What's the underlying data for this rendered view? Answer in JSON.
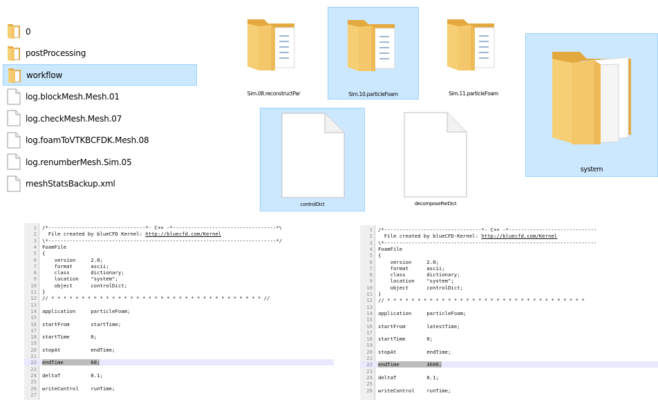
{
  "file_list": [
    {
      "name": "0",
      "icon": "folder-icon",
      "selected": false
    },
    {
      "name": "postProcessing",
      "icon": "folder-icon",
      "selected": false
    },
    {
      "name": "workflow",
      "icon": "folder-icon",
      "selected": true
    },
    {
      "name": "log.blockMesh.Mesh.01",
      "icon": "file-icon",
      "selected": false
    },
    {
      "name": "log.checkMesh.Mesh.07",
      "icon": "file-icon",
      "selected": false
    },
    {
      "name": "log.foamToVTKBCFDK.Mesh.08",
      "icon": "file-icon",
      "selected": false
    },
    {
      "name": "log.renumberMesh.Sim.05",
      "icon": "file-icon",
      "selected": false
    },
    {
      "name": "meshStatsBackup.xml",
      "icon": "file-icon",
      "selected": false
    }
  ],
  "icons": {
    "sim08": "Sim.08.reconstructPar",
    "sim10": "Sim.10.particleFoam",
    "sim11": "Sim.11.particleFoam",
    "system": "system",
    "controlDict": "controlDict",
    "decomposeParDict": "decomposeParDict"
  },
  "colors": {
    "selection_bg": "#cce8ff",
    "selection_border": "#99d1ff",
    "folder": "#f4c86a",
    "highlight_line": "#e8e8ff"
  },
  "editor_left": {
    "lines": [
      {
        "n": "1",
        "text": "/*--------------------------------*- C++ -*----------------------------------*\\"
      },
      {
        "n": "2",
        "text": "  File created by blueCFD Kernel: ",
        "url": "http://bluecfd.com/Kernel"
      },
      {
        "n": "3",
        "text": "\\*---------------------------------------------------------------------------*/"
      },
      {
        "n": "4",
        "text": "FoamFile"
      },
      {
        "n": "5",
        "text": "{"
      },
      {
        "n": "6",
        "text": "    version     2.0;"
      },
      {
        "n": "7",
        "text": "    format      ascii;"
      },
      {
        "n": "8",
        "text": "    class       dictionary;"
      },
      {
        "n": "9",
        "text": "    location    \"system\";"
      },
      {
        "n": "10",
        "text": "    object      controlDict;"
      },
      {
        "n": "11",
        "text": "}"
      },
      {
        "n": "12",
        "text": "// * * * * * * * * * * * * * * * * * * * * * * * * * * * * * * * * * * * //"
      },
      {
        "n": "13",
        "text": ""
      },
      {
        "n": "14",
        "text": "application     particleFoam;"
      },
      {
        "n": "15",
        "text": ""
      },
      {
        "n": "16",
        "text": "startFrom       startTime;"
      },
      {
        "n": "17",
        "text": ""
      },
      {
        "n": "18",
        "text": "startTime       0;"
      },
      {
        "n": "19",
        "text": ""
      },
      {
        "n": "20",
        "text": "stopAt          endTime;"
      },
      {
        "n": "21",
        "text": ""
      },
      {
        "n": "22",
        "text": "endTime         60;",
        "highlight": true
      },
      {
        "n": "23",
        "text": ""
      },
      {
        "n": "24",
        "text": "deltaT          0.1;"
      },
      {
        "n": "25",
        "text": ""
      },
      {
        "n": "26",
        "text": "writeControl    runTime;"
      },
      {
        "n": "27",
        "text": ""
      }
    ]
  },
  "editor_right": {
    "lines": [
      {
        "n": "1",
        "text": "/*--------------------------------*- C++ -*-----------------------------"
      },
      {
        "n": "2",
        "text": "  File created by blueCFD-Kernel: ",
        "url": "http://bluecfd.com/Kernel"
      },
      {
        "n": "3",
        "text": "\\*----------------------------------------------------------------------"
      },
      {
        "n": "4",
        "text": "FoamFile"
      },
      {
        "n": "5",
        "text": "{"
      },
      {
        "n": "6",
        "text": "    version     2.0;"
      },
      {
        "n": "7",
        "text": "    format      ascii;"
      },
      {
        "n": "8",
        "text": "    class       dictionary;"
      },
      {
        "n": "9",
        "text": "    location    \"system\";"
      },
      {
        "n": "10",
        "text": "    object      controlDict;"
      },
      {
        "n": "11",
        "text": "}"
      },
      {
        "n": "12",
        "text": "// * * * * * * * * * * * * * * * * * * * * * * * * * * * * * * * * *"
      },
      {
        "n": "13",
        "text": ""
      },
      {
        "n": "14",
        "text": "application     particleFoam;"
      },
      {
        "n": "15",
        "text": ""
      },
      {
        "n": "16",
        "text": "startFrom       latestTime;"
      },
      {
        "n": "17",
        "text": ""
      },
      {
        "n": "18",
        "text": "startTime       0;"
      },
      {
        "n": "19",
        "text": ""
      },
      {
        "n": "20",
        "text": "stopAt          endTime;"
      },
      {
        "n": "21",
        "text": ""
      },
      {
        "n": "22",
        "text": "endTime         3600;",
        "highlight": true
      },
      {
        "n": "23",
        "text": ""
      },
      {
        "n": "24",
        "text": "deltaT          0.1;"
      },
      {
        "n": "25",
        "text": ""
      },
      {
        "n": "26",
        "text": "writeControl    runTime;"
      }
    ]
  }
}
